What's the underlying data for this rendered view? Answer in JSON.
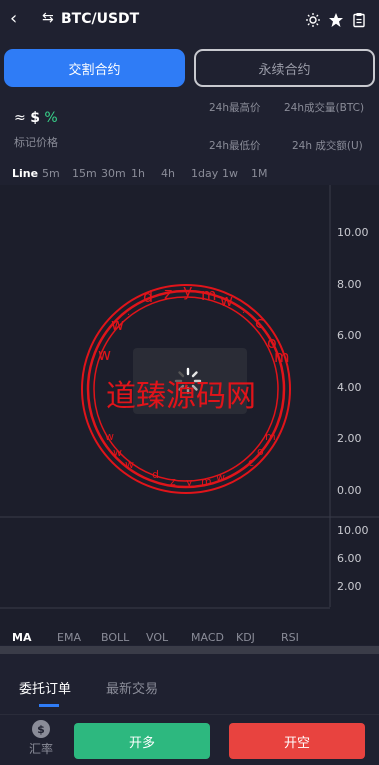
{
  "header": {
    "back_icon": "chevron-left-icon",
    "swap_icon": "swap-arrows-icon",
    "pair": "BTC/USDT",
    "icons": [
      "brightness-icon",
      "star-icon",
      "clipboard-icon"
    ]
  },
  "tabs": [
    {
      "label": "交割合约",
      "active": true
    },
    {
      "label": "永续合约",
      "active": false
    }
  ],
  "price": {
    "approx": "≈",
    "dollar": "$",
    "pct": "%"
  },
  "mark_label": "标记价格",
  "stats": {
    "high": "24h最高价",
    "low": "24h最低价",
    "vol_btc": "24h成交量(BTC)",
    "vol_u": "24h 成交额(U)"
  },
  "timeframes": [
    "Line",
    "5m",
    "15m",
    "30m",
    "1h",
    "4h",
    "1day",
    "1w",
    "1M"
  ],
  "chart_axis": {
    "main": [
      "10.00",
      "8.00",
      "6.00",
      "4.00",
      "2.00",
      "0.00"
    ],
    "sub": [
      "10.00",
      "6.00",
      "2.00"
    ]
  },
  "indicators": [
    "MA",
    "EMA",
    "BOLL",
    "VOL",
    "MACD",
    "KDJ",
    "RSI"
  ],
  "order_tabs": [
    {
      "label": "委托订单",
      "active": true
    },
    {
      "label": "最新交易",
      "active": false
    }
  ],
  "bottom": {
    "rate_icon": "dollar-coin-icon",
    "rate_label": "汇率",
    "long_label": "开多",
    "short_label": "开空"
  },
  "watermark": {
    "text": "道臻源码网",
    "letters": "dzymw.com"
  },
  "colors": {
    "accent": "#2f7cf6",
    "up": "#2db87f",
    "down": "#e8433f",
    "watermark": "#e0141a"
  }
}
